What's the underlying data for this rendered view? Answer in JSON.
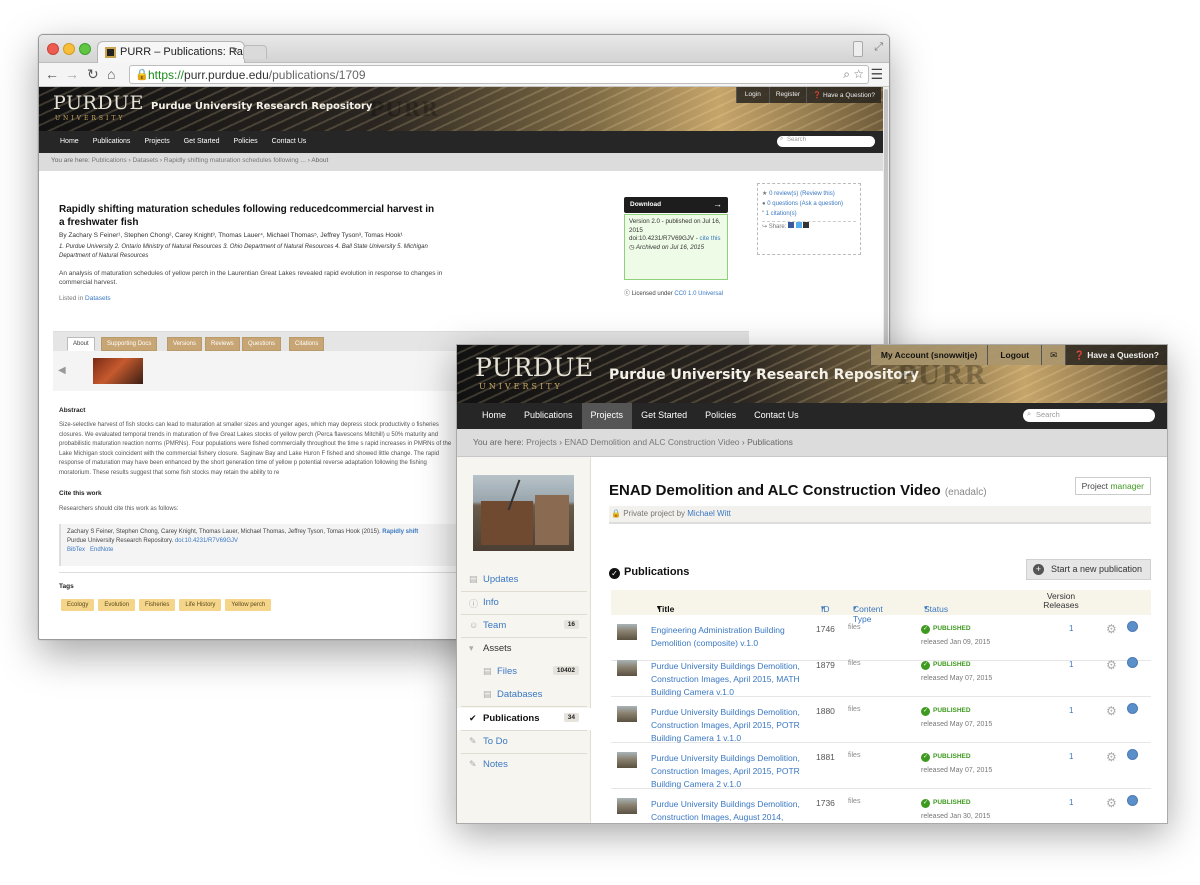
{
  "back_window": {
    "tab_title": "PURR – Publications: Rapid",
    "tab_close": "×",
    "url_scheme": "https://",
    "url_host": "purr.purdue.edu",
    "url_path": "/publications/1709",
    "logo_main": "PURDUE",
    "logo_sub": "UNIVERSITY",
    "repo_title": "Purdue University Research Repository",
    "purr_mark": "PURR",
    "acct": {
      "login": "Login",
      "register": "Register",
      "question": "Have a Question?"
    },
    "nav": [
      "Home",
      "Publications",
      "Projects",
      "Get Started",
      "Policies",
      "Contact Us"
    ],
    "search_placeholder": "Search",
    "crumbs": {
      "prefix": "You are here:",
      "items": [
        "Publications",
        "Datasets",
        "Rapidly shifting maturation schedules following ...",
        "About"
      ]
    },
    "pub": {
      "title": "Rapidly shifting maturation schedules following reducedcommercial harvest in a freshwater fish",
      "authors": "By Zachary S Feiner¹, Stephen Chong², Carey Knight³, Thomas Lauer⁴, Michael Thomas⁵, Jeffrey Tyson³, Tomas Hook¹",
      "affiliations": "1. Purdue University 2. Ontario Ministry of Natural Resources 3. Ohio Department of Natural Resources 4. Ball State University 5. Michigan Department of Natural Resources",
      "summary": "An analysis of maturation schedules of yellow perch in the Laurentian Great Lakes revealed rapid evolution in response to changes in commercial harvest.",
      "listed_prefix": "Listed in",
      "listed_link": "Datasets"
    },
    "download": {
      "label": "Download",
      "arrow": "→"
    },
    "version": {
      "line1": "Version 2.0 - published on Jul 16, 2015",
      "doi": "doi:10.4231/R7V69GJV -",
      "cite_link": "cite this",
      "archived": "Archived on Jul 16, 2015"
    },
    "license": {
      "prefix": "Licensed under",
      "name": "CC0 1.0 Universal"
    },
    "meta": {
      "reviews": "0 review(s) (Review this)",
      "questions": "0 questions (Ask a question)",
      "citations": "1 citation(s)",
      "share": "Share:"
    },
    "tabs": [
      "About",
      "Supporting Docs",
      "Versions",
      "Reviews",
      "Questions",
      "Citations"
    ],
    "abstract_heading": "Abstract",
    "abstract_text": "Size-selective harvest of fish stocks can lead to maturation at smaller sizes and younger ages, which may depress stock productivity o fisheries closures.  We evaluated temporal trends in maturation of five Great Lakes stocks of yellow perch (Perca flavescens Mitchill) u 50% maturity and probabilistic maturation reaction norms (PMRNs).  Four populations were fished commercially throughout the time s rapid increases in PMRNs of the Lake Michigan stock coincident with the commercial fishery closure.  Saginaw Bay and Lake Huron F fished and showed little change.  The rapid response of maturation may have been enhanced by the short generation time of yellow p potential reverse adaptation following the fishing moratorium. These results suggest that some fish stocks may retain the ability to re",
    "cite_heading": "Cite this work",
    "cite_intro": "Researchers should cite this work as follows:",
    "cite_text": "Zachary S Feiner, Stephen Chong, Carey Knight, Thomas Lauer, Michael Thomas, Jeffrey Tyson, Tomas Hook (2015).",
    "cite_link": "Rapidly shift",
    "cite_repo": "Purdue University Research Repository.",
    "cite_doi": "doi:10.4231/R7V69GJV",
    "bibtex": "BibTex",
    "endnote": "EndNote",
    "tags_heading": "Tags",
    "tags": [
      "Ecology",
      "Evolution",
      "Fisheries",
      "Life History",
      "Yellow perch"
    ]
  },
  "front_window": {
    "acct": {
      "my_account": "My Account (snowwitje)",
      "logout": "Logout",
      "question": "Have a Question?"
    },
    "logo_main": "PURDUE",
    "logo_sub": "UNIVERSITY",
    "repo_title": "Purdue University Research Repository",
    "purr_mark": "PURR",
    "nav": [
      "Home",
      "Publications",
      "Projects",
      "Get Started",
      "Policies",
      "Contact Us"
    ],
    "nav_active": "Projects",
    "search_placeholder": "Search",
    "crumbs": {
      "prefix": "You are here:",
      "items": [
        "Projects",
        "ENAD Demolition and ALC Construction Video",
        "Publications"
      ]
    },
    "sidebar": [
      {
        "label": "Updates",
        "icon": "updates-icon",
        "glyph": "▤"
      },
      {
        "label": "Info",
        "icon": "info-icon",
        "glyph": "ⓘ"
      },
      {
        "label": "Team",
        "icon": "team-icon",
        "glyph": "👥",
        "count": "16"
      },
      {
        "label": "Assets",
        "icon": "chevron-down-icon",
        "glyph": "▾"
      },
      {
        "label": "Files",
        "icon": "file-icon",
        "glyph": "▤",
        "count": "10402"
      },
      {
        "label": "Databases",
        "icon": "database-icon",
        "glyph": "▤"
      },
      {
        "label": "Publications",
        "icon": "check-icon",
        "glyph": "✔",
        "count": "34"
      },
      {
        "label": "To Do",
        "icon": "todo-icon",
        "glyph": "✎"
      },
      {
        "label": "Notes",
        "icon": "notes-icon",
        "glyph": "✎"
      }
    ],
    "project": {
      "title": "ENAD Demolition and ALC Construction Video",
      "alias": "(enadalc)",
      "role_prefix": "Project",
      "role": "manager",
      "privacy": "Private",
      "project_by": "project by",
      "owner": "Michael Witt"
    },
    "publications_heading": "Publications",
    "start_button": "Start a new publication",
    "table_headers": {
      "title": "Title",
      "id": "ID",
      "content_type": "Content Type",
      "status": "Status",
      "version_releases": "Version Releases"
    },
    "rows": [
      {
        "title": "Engineering Administration Building Demolition (composite) v.1.0",
        "id": "1746",
        "type": "files",
        "status": "PUBLISHED",
        "released": "released Jan 09, 2015",
        "versions": "1"
      },
      {
        "title": "Purdue University Buildings Demolition, Construction Images, April 2015, MATH Building Camera v.1.0",
        "id": "1879",
        "type": "files",
        "status": "PUBLISHED",
        "released": "released May 07, 2015",
        "versions": "1"
      },
      {
        "title": "Purdue University Buildings Demolition, Construction Images, April 2015, POTR Building Camera 1 v.1.0",
        "id": "1880",
        "type": "files",
        "status": "PUBLISHED",
        "released": "released May 07, 2015",
        "versions": "1"
      },
      {
        "title": "Purdue University Buildings Demolition, Construction Images, April 2015, POTR Building Camera 2 v.1.0",
        "id": "1881",
        "type": "files",
        "status": "PUBLISHED",
        "released": "released May 07, 2015",
        "versions": "1"
      },
      {
        "title": "Purdue University Buildings Demolition, Construction Images, August 2014,",
        "id": "1736",
        "type": "files",
        "status": "PUBLISHED",
        "released": "released Jan 30, 2015",
        "versions": "1"
      }
    ]
  }
}
